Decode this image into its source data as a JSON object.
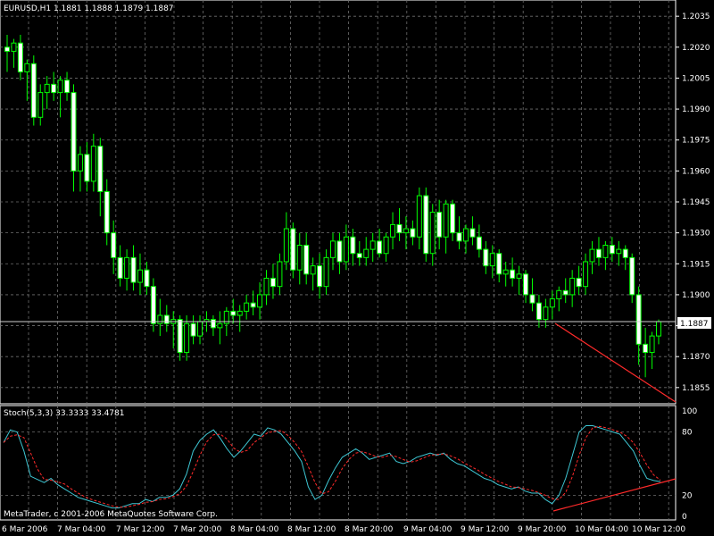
{
  "header": {
    "symbol_line": "EURUSD,H1  1.1881 1.1888 1.1879 1.1887"
  },
  "price_tag": "1.1887",
  "stoch_label": "Stoch(5,3,3) 33.3333 33.4781",
  "copyright": "MetaTrader, c 2001-2006 MetaQuotes Software Corp.",
  "colors": {
    "background": "#000000",
    "grid": "#6f6f6f",
    "candle": "#00ff00",
    "candle_body_up": "#000000",
    "candle_body_down": "#ffffff",
    "stoch_main": "#3ec7d4",
    "stoch_signal": "#ff2a2a",
    "trend_line": "#ff2a2a",
    "text": "#ffffff"
  },
  "price_axis": {
    "labels": [
      "1.2035",
      "1.2020",
      "1.2005",
      "1.1990",
      "1.1975",
      "1.1960",
      "1.1945",
      "1.1930",
      "1.1915",
      "1.1900",
      "1.1885",
      "1.1870",
      "1.1855"
    ]
  },
  "stoch_axis": {
    "labels": [
      "100",
      "80",
      "20",
      "0"
    ]
  },
  "time_axis": {
    "labels": [
      "6 Mar 2006",
      "7 Mar 04:00",
      "7 Mar 12:00",
      "7 Mar 20:00",
      "8 Mar 04:00",
      "8 Mar 12:00",
      "8 Mar 20:00",
      "9 Mar 04:00",
      "9 Mar 12:00",
      "9 Mar 20:00",
      "10 Mar 04:00",
      "10 Mar 12:00"
    ]
  },
  "chart_data": {
    "type": "candlestick",
    "symbol": "EURUSD",
    "timeframe": "H1",
    "ylim": [
      1.1848,
      1.2042
    ],
    "current_price": 1.1887,
    "ohlc": [
      {
        "o": 1.202,
        "h": 1.2026,
        "l": 1.2008,
        "c": 1.2018
      },
      {
        "o": 1.2018,
        "h": 1.2024,
        "l": 1.201,
        "c": 1.2022
      },
      {
        "o": 1.2022,
        "h": 1.2026,
        "l": 1.2004,
        "c": 1.2008
      },
      {
        "o": 1.2008,
        "h": 1.2014,
        "l": 1.1994,
        "c": 1.2012
      },
      {
        "o": 1.2012,
        "h": 1.2016,
        "l": 1.1982,
        "c": 1.1986
      },
      {
        "o": 1.1986,
        "h": 1.2002,
        "l": 1.1982,
        "c": 1.1998
      },
      {
        "o": 1.1998,
        "h": 1.2006,
        "l": 1.199,
        "c": 1.2002
      },
      {
        "o": 1.2002,
        "h": 1.2008,
        "l": 1.1994,
        "c": 1.1998
      },
      {
        "o": 1.1998,
        "h": 1.2006,
        "l": 1.1986,
        "c": 1.2004
      },
      {
        "o": 1.2004,
        "h": 1.2008,
        "l": 1.1994,
        "c": 1.1998
      },
      {
        "o": 1.1998,
        "h": 1.2002,
        "l": 1.195,
        "c": 1.196
      },
      {
        "o": 1.196,
        "h": 1.1972,
        "l": 1.195,
        "c": 1.1968
      },
      {
        "o": 1.1968,
        "h": 1.1974,
        "l": 1.195,
        "c": 1.1955
      },
      {
        "o": 1.1955,
        "h": 1.1978,
        "l": 1.195,
        "c": 1.1972
      },
      {
        "o": 1.1972,
        "h": 1.1976,
        "l": 1.1938,
        "c": 1.195
      },
      {
        "o": 1.195,
        "h": 1.1956,
        "l": 1.1924,
        "c": 1.193
      },
      {
        "o": 1.193,
        "h": 1.1936,
        "l": 1.191,
        "c": 1.1918
      },
      {
        "o": 1.1918,
        "h": 1.1924,
        "l": 1.1904,
        "c": 1.1908
      },
      {
        "o": 1.1908,
        "h": 1.1922,
        "l": 1.1902,
        "c": 1.1918
      },
      {
        "o": 1.1918,
        "h": 1.1924,
        "l": 1.1902,
        "c": 1.1906
      },
      {
        "o": 1.1906,
        "h": 1.192,
        "l": 1.19,
        "c": 1.1912
      },
      {
        "o": 1.1912,
        "h": 1.1916,
        "l": 1.19,
        "c": 1.1904
      },
      {
        "o": 1.1904,
        "h": 1.1908,
        "l": 1.1882,
        "c": 1.1886
      },
      {
        "o": 1.1886,
        "h": 1.1898,
        "l": 1.188,
        "c": 1.189
      },
      {
        "o": 1.189,
        "h": 1.1895,
        "l": 1.1882,
        "c": 1.1886
      },
      {
        "o": 1.1886,
        "h": 1.1892,
        "l": 1.1874,
        "c": 1.1888
      },
      {
        "o": 1.1888,
        "h": 1.189,
        "l": 1.1868,
        "c": 1.1872
      },
      {
        "o": 1.1872,
        "h": 1.189,
        "l": 1.1868,
        "c": 1.1886
      },
      {
        "o": 1.1886,
        "h": 1.189,
        "l": 1.1876,
        "c": 1.188
      },
      {
        "o": 1.188,
        "h": 1.189,
        "l": 1.1876,
        "c": 1.1887
      },
      {
        "o": 1.1887,
        "h": 1.1892,
        "l": 1.1882,
        "c": 1.1888
      },
      {
        "o": 1.1888,
        "h": 1.189,
        "l": 1.188,
        "c": 1.1884
      },
      {
        "o": 1.1884,
        "h": 1.1892,
        "l": 1.1876,
        "c": 1.1886
      },
      {
        "o": 1.1886,
        "h": 1.1894,
        "l": 1.188,
        "c": 1.1892
      },
      {
        "o": 1.1892,
        "h": 1.1898,
        "l": 1.1886,
        "c": 1.189
      },
      {
        "o": 1.189,
        "h": 1.1895,
        "l": 1.1882,
        "c": 1.1892
      },
      {
        "o": 1.1892,
        "h": 1.19,
        "l": 1.1888,
        "c": 1.1896
      },
      {
        "o": 1.1896,
        "h": 1.1902,
        "l": 1.189,
        "c": 1.1894
      },
      {
        "o": 1.1894,
        "h": 1.1906,
        "l": 1.1888,
        "c": 1.19
      },
      {
        "o": 1.19,
        "h": 1.1912,
        "l": 1.1895,
        "c": 1.1908
      },
      {
        "o": 1.1908,
        "h": 1.1915,
        "l": 1.1898,
        "c": 1.1904
      },
      {
        "o": 1.1904,
        "h": 1.192,
        "l": 1.19,
        "c": 1.1916
      },
      {
        "o": 1.1916,
        "h": 1.194,
        "l": 1.1912,
        "c": 1.1932
      },
      {
        "o": 1.1932,
        "h": 1.1935,
        "l": 1.1908,
        "c": 1.1912
      },
      {
        "o": 1.1912,
        "h": 1.193,
        "l": 1.1905,
        "c": 1.1924
      },
      {
        "o": 1.1924,
        "h": 1.193,
        "l": 1.1905,
        "c": 1.191
      },
      {
        "o": 1.191,
        "h": 1.1918,
        "l": 1.1902,
        "c": 1.1914
      },
      {
        "o": 1.1914,
        "h": 1.192,
        "l": 1.1898,
        "c": 1.1904
      },
      {
        "o": 1.1904,
        "h": 1.1922,
        "l": 1.19,
        "c": 1.1918
      },
      {
        "o": 1.1918,
        "h": 1.193,
        "l": 1.1912,
        "c": 1.1926
      },
      {
        "o": 1.1926,
        "h": 1.193,
        "l": 1.191,
        "c": 1.1916
      },
      {
        "o": 1.1916,
        "h": 1.1934,
        "l": 1.1912,
        "c": 1.1928
      },
      {
        "o": 1.1928,
        "h": 1.1932,
        "l": 1.1914,
        "c": 1.192
      },
      {
        "o": 1.192,
        "h": 1.1926,
        "l": 1.1914,
        "c": 1.1918
      },
      {
        "o": 1.1918,
        "h": 1.1928,
        "l": 1.1914,
        "c": 1.1922
      },
      {
        "o": 1.1922,
        "h": 1.193,
        "l": 1.1916,
        "c": 1.1926
      },
      {
        "o": 1.1926,
        "h": 1.1932,
        "l": 1.1918,
        "c": 1.192
      },
      {
        "o": 1.192,
        "h": 1.193,
        "l": 1.1916,
        "c": 1.1928
      },
      {
        "o": 1.1928,
        "h": 1.194,
        "l": 1.1922,
        "c": 1.1934
      },
      {
        "o": 1.1934,
        "h": 1.1942,
        "l": 1.1926,
        "c": 1.193
      },
      {
        "o": 1.193,
        "h": 1.1938,
        "l": 1.1922,
        "c": 1.1932
      },
      {
        "o": 1.1932,
        "h": 1.1936,
        "l": 1.1924,
        "c": 1.1928
      },
      {
        "o": 1.1928,
        "h": 1.1952,
        "l": 1.1922,
        "c": 1.1948
      },
      {
        "o": 1.1948,
        "h": 1.1952,
        "l": 1.1916,
        "c": 1.192
      },
      {
        "o": 1.192,
        "h": 1.1944,
        "l": 1.1914,
        "c": 1.194
      },
      {
        "o": 1.194,
        "h": 1.1946,
        "l": 1.1922,
        "c": 1.1928
      },
      {
        "o": 1.1928,
        "h": 1.1946,
        "l": 1.192,
        "c": 1.1944
      },
      {
        "o": 1.1944,
        "h": 1.1946,
        "l": 1.1926,
        "c": 1.193
      },
      {
        "o": 1.193,
        "h": 1.1938,
        "l": 1.1922,
        "c": 1.1926
      },
      {
        "o": 1.1926,
        "h": 1.1934,
        "l": 1.192,
        "c": 1.1932
      },
      {
        "o": 1.1932,
        "h": 1.1938,
        "l": 1.1924,
        "c": 1.1928
      },
      {
        "o": 1.1928,
        "h": 1.1934,
        "l": 1.1918,
        "c": 1.1922
      },
      {
        "o": 1.1922,
        "h": 1.1926,
        "l": 1.191,
        "c": 1.1914
      },
      {
        "o": 1.1914,
        "h": 1.1924,
        "l": 1.1908,
        "c": 1.192
      },
      {
        "o": 1.192,
        "h": 1.1922,
        "l": 1.1906,
        "c": 1.191
      },
      {
        "o": 1.191,
        "h": 1.1916,
        "l": 1.1904,
        "c": 1.1912
      },
      {
        "o": 1.1912,
        "h": 1.1918,
        "l": 1.1904,
        "c": 1.1908
      },
      {
        "o": 1.1908,
        "h": 1.1914,
        "l": 1.19,
        "c": 1.191
      },
      {
        "o": 1.191,
        "h": 1.1912,
        "l": 1.1896,
        "c": 1.19
      },
      {
        "o": 1.19,
        "h": 1.1908,
        "l": 1.1892,
        "c": 1.1896
      },
      {
        "o": 1.1896,
        "h": 1.19,
        "l": 1.1884,
        "c": 1.1888
      },
      {
        "o": 1.1888,
        "h": 1.1898,
        "l": 1.1884,
        "c": 1.1894
      },
      {
        "o": 1.1894,
        "h": 1.1902,
        "l": 1.1888,
        "c": 1.1898
      },
      {
        "o": 1.1898,
        "h": 1.1904,
        "l": 1.1892,
        "c": 1.1902
      },
      {
        "o": 1.1902,
        "h": 1.1908,
        "l": 1.1896,
        "c": 1.19
      },
      {
        "o": 1.19,
        "h": 1.1912,
        "l": 1.1894,
        "c": 1.1908
      },
      {
        "o": 1.1908,
        "h": 1.1914,
        "l": 1.19,
        "c": 1.1904
      },
      {
        "o": 1.1904,
        "h": 1.192,
        "l": 1.19,
        "c": 1.1916
      },
      {
        "o": 1.1916,
        "h": 1.1926,
        "l": 1.191,
        "c": 1.1922
      },
      {
        "o": 1.1922,
        "h": 1.1928,
        "l": 1.1914,
        "c": 1.1918
      },
      {
        "o": 1.1918,
        "h": 1.1926,
        "l": 1.1912,
        "c": 1.1924
      },
      {
        "o": 1.1924,
        "h": 1.1928,
        "l": 1.1916,
        "c": 1.192
      },
      {
        "o": 1.192,
        "h": 1.1926,
        "l": 1.1914,
        "c": 1.1922
      },
      {
        "o": 1.1922,
        "h": 1.1924,
        "l": 1.1912,
        "c": 1.1918
      },
      {
        "o": 1.1918,
        "h": 1.192,
        "l": 1.1896,
        "c": 1.19
      },
      {
        "o": 1.19,
        "h": 1.1904,
        "l": 1.1866,
        "c": 1.1876
      },
      {
        "o": 1.1876,
        "h": 1.1884,
        "l": 1.186,
        "c": 1.1872
      },
      {
        "o": 1.1872,
        "h": 1.1882,
        "l": 1.1864,
        "c": 1.188
      },
      {
        "o": 1.188,
        "h": 1.1888,
        "l": 1.1876,
        "c": 1.1887
      }
    ],
    "stochastic": {
      "params": "5,3,3",
      "main_value": 33.3333,
      "signal_value": 33.4781
    },
    "stoch_main": [
      70,
      82,
      80,
      62,
      38,
      35,
      32,
      36,
      30,
      26,
      22,
      18,
      16,
      14,
      12,
      10,
      8,
      8,
      10,
      12,
      12,
      16,
      14,
      18,
      18,
      20,
      26,
      40,
      62,
      72,
      78,
      82,
      74,
      64,
      56,
      62,
      70,
      78,
      76,
      84,
      82,
      78,
      70,
      62,
      52,
      28,
      16,
      20,
      34,
      46,
      56,
      60,
      64,
      60,
      54,
      56,
      58,
      60,
      52,
      50,
      52,
      56,
      58,
      60,
      58,
      60,
      54,
      50,
      48,
      44,
      40,
      36,
      34,
      30,
      28,
      26,
      28,
      24,
      22,
      22,
      16,
      12,
      20,
      36,
      58,
      80,
      86,
      86,
      84,
      82,
      80,
      78,
      70,
      62,
      48,
      36,
      34,
      33
    ]
  }
}
